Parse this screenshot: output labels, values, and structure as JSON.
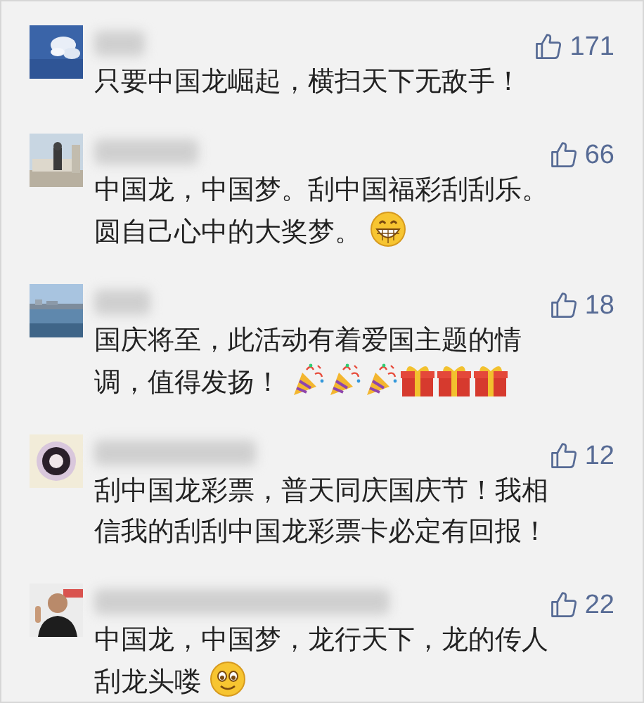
{
  "comments": [
    {
      "likes": "171",
      "lines": [
        "只要中国龙崛起，横扫天下无敌手！"
      ]
    },
    {
      "likes": "66",
      "lines": [
        "中国龙，中国梦。刮中国福彩刮刮乐。",
        "圆自己心中的大奖梦。"
      ],
      "emoji": [
        {
          "kind": "grin"
        }
      ]
    },
    {
      "likes": "18",
      "lines": [
        "国庆将至，此活动有着爱国主题的情",
        "调，值得发扬！"
      ],
      "emoji": [
        {
          "kind": "party"
        },
        {
          "kind": "party"
        },
        {
          "kind": "party"
        },
        {
          "kind": "gift"
        },
        {
          "kind": "gift"
        },
        {
          "kind": "gift"
        }
      ]
    },
    {
      "likes": "12",
      "lines": [
        "刮中国龙彩票，普天同庆国庆节！我相",
        "信我的刮刮中国龙彩票卡必定有回报！"
      ]
    },
    {
      "likes": "22",
      "lines": [
        "中国龙，中国梦，龙行天下，龙的传人",
        "刮龙头喽"
      ],
      "emoji": [
        {
          "kind": "smile"
        }
      ]
    }
  ]
}
